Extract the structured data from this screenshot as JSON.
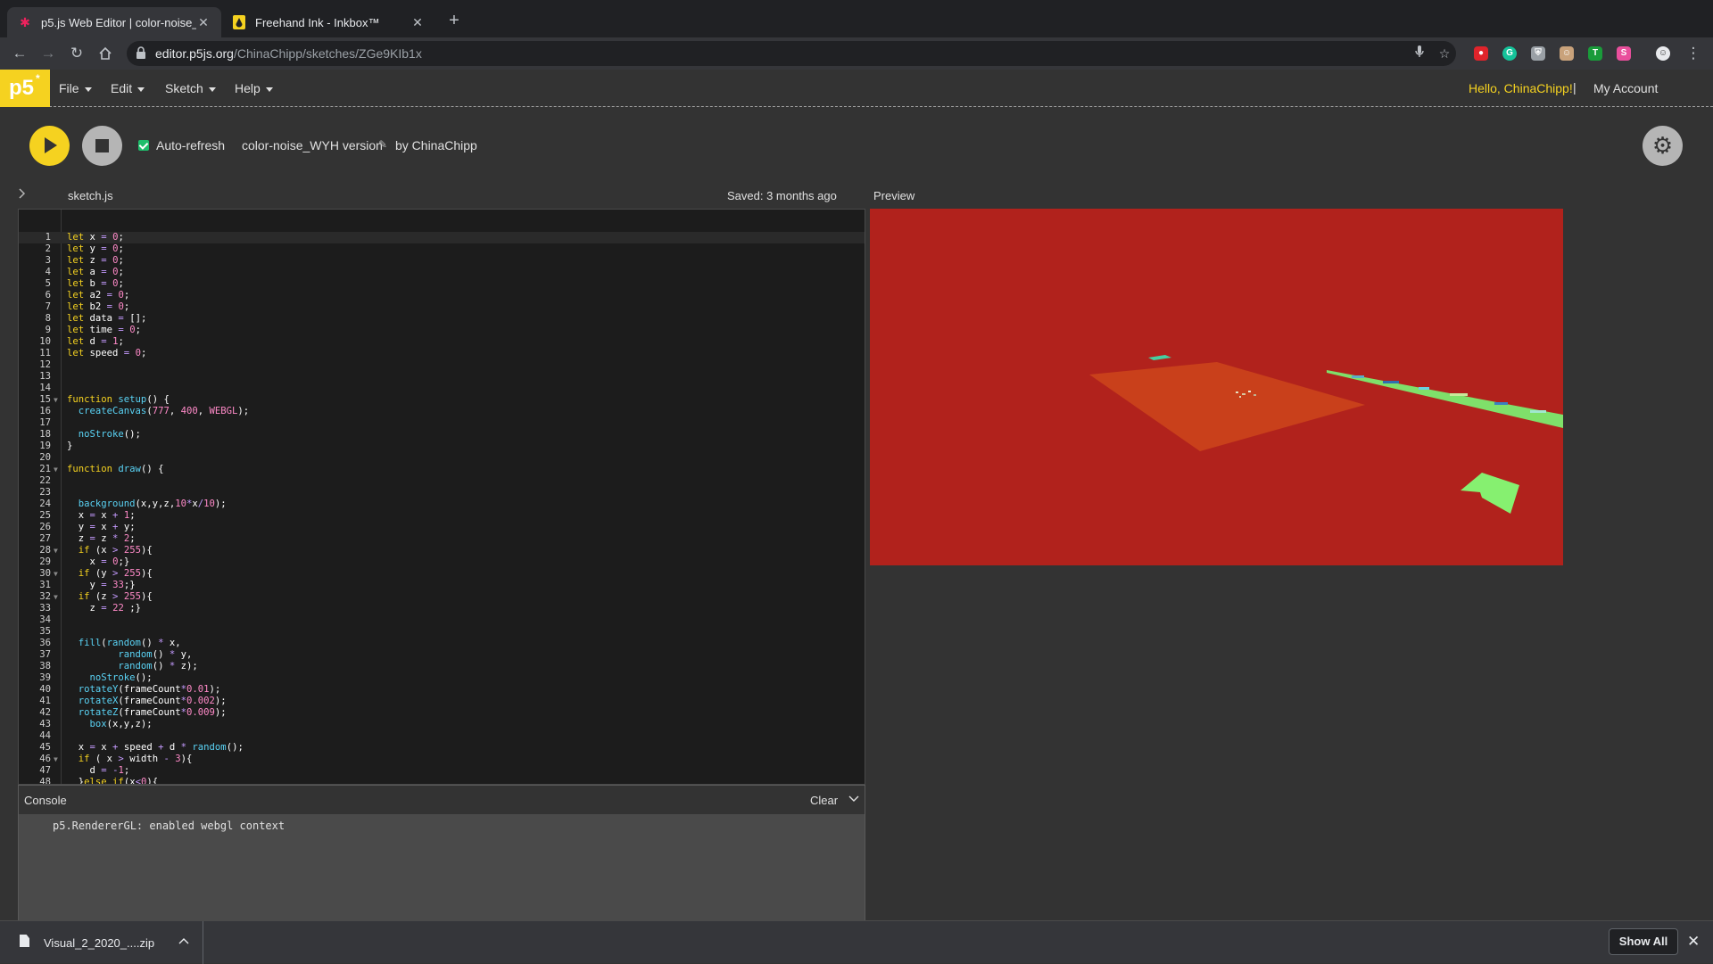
{
  "browser": {
    "tabs": [
      {
        "title": "p5.js Web Editor | color-noise_",
        "favicon": "p5-star-icon"
      },
      {
        "title": "Freehand Ink - Inkbox™",
        "favicon": "inkbox-icon"
      }
    ],
    "url_domain": "editor.p5js.org",
    "url_path": "/ChinaChipp/sketches/ZGe9KIb1x"
  },
  "nav": {
    "logo": "p5",
    "menus": [
      "File",
      "Edit",
      "Sketch",
      "Help"
    ],
    "greeting": "Hello, ChinaChipp!",
    "separator": "|",
    "account": "My Account"
  },
  "toolbar": {
    "auto_refresh_label": "Auto-refresh",
    "auto_refresh_checked": true,
    "sketch_name": "color-noise_WYH version",
    "by_line": "by ChinaChipp"
  },
  "editor": {
    "filename": "sketch.js",
    "saved_status": "Saved: 3 months ago",
    "lines": [
      "let x = 0;",
      "let y = 0;",
      "let z = 0;",
      "let a = 0;",
      "let b = 0;",
      "let a2 = 0;",
      "let b2 = 0;",
      "let data = [];",
      "let time = 0;",
      "let d = 1;",
      "let speed = 0;",
      "",
      "",
      "",
      "function setup() {",
      "  createCanvas(777, 400, WEBGL);",
      "",
      "  noStroke();",
      "}",
      "",
      "function draw() {",
      "",
      "",
      "  background(x,y,z,10*x/10);",
      "  x = x + 1;",
      "  y = x + y;",
      "  z = z * 2;",
      "  if (x > 255){",
      "    x = 0;}",
      "  if (y > 255){",
      "    y = 33;}",
      "  if (z > 255){",
      "    z = 22 ;}",
      "",
      "",
      "  fill(random() * x,",
      "         random() * y,",
      "         random() * z);",
      "    noStroke();",
      "  rotateY(frameCount*0.01);",
      "  rotateX(frameCount*0.002);",
      "  rotateZ(frameCount*0.009);",
      "    box(x,y,z);",
      "",
      "  x = x + speed + d * random();",
      "  if ( x > width - 3){",
      "    d = -1;",
      "  }else if(x<0){"
    ],
    "fold_lines": [
      15,
      21,
      28,
      30,
      32,
      46
    ]
  },
  "preview": {
    "label": "Preview",
    "background_color": "#b1221c"
  },
  "console": {
    "title": "Console",
    "clear_label": "Clear",
    "messages": [
      "p5.RendererGL: enabled webgl context"
    ]
  },
  "downloads": {
    "file_name": "Visual_2_2020_....zip",
    "show_all_label": "Show All"
  },
  "colors": {
    "accent_yellow": "#f5d220",
    "checkbox_green": "#1ebd6b",
    "code_keyword": "#f5d220",
    "code_function": "#5ad3f5",
    "code_number": "#ff8ac8"
  }
}
